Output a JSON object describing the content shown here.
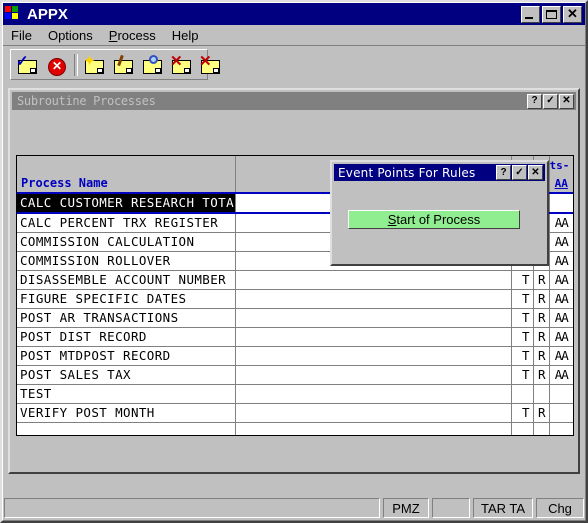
{
  "window": {
    "title": "APPX",
    "icon": "windows-logo-icon",
    "controls": [
      {
        "name": "minimize-button",
        "glyph": "_"
      },
      {
        "name": "maximize-button",
        "glyph": "□"
      },
      {
        "name": "close-button",
        "glyph": "✕"
      }
    ]
  },
  "menubar": {
    "items": [
      {
        "label": "File",
        "accel": ""
      },
      {
        "label": "Options",
        "accel": ""
      },
      {
        "label": "Process",
        "accel": "P"
      },
      {
        "label": "Help",
        "accel": ""
      }
    ]
  },
  "toolbar": {
    "buttons": [
      {
        "name": "confirm-folder-icon",
        "tip": "OK"
      },
      {
        "name": "cancel-circle-icon",
        "tip": "Cancel"
      },
      {
        "name": "new-folder-icon",
        "tip": "New"
      },
      {
        "name": "edit-folder-icon",
        "tip": "Edit"
      },
      {
        "name": "scan-folder-icon",
        "tip": "Scan"
      },
      {
        "name": "delete-folder-icon",
        "tip": "Delete"
      },
      {
        "name": "delete-all-folder-icon",
        "tip": "Delete All"
      }
    ]
  },
  "mdi": {
    "title": "Subroutine Processes",
    "buttons": [
      {
        "name": "help-button",
        "glyph": "?"
      },
      {
        "name": "accept-button",
        "glyph": "✓"
      },
      {
        "name": "cancel-button",
        "glyph": "✕"
      }
    ]
  },
  "grid": {
    "headers": {
      "name": "Process Name",
      "blank": "",
      "t": "",
      "r": "",
      "cut": "ts-",
      "aa": "AA"
    },
    "rows": [
      {
        "name": "CALC CUSTOMER RESEARCH TOTALS",
        "blank": "",
        "t": "",
        "r": "",
        "aa": "",
        "selected": true
      },
      {
        "name": "CALC PERCENT TRX REGISTER",
        "blank": "",
        "t": "",
        "r": "",
        "aa": "AA",
        "selected": false
      },
      {
        "name": "COMMISSION CALCULATION",
        "blank": "",
        "t": "",
        "r": "",
        "aa": "AA",
        "selected": false
      },
      {
        "name": "COMMISSION ROLLOVER",
        "blank": "",
        "t": "",
        "r": "",
        "aa": "AA",
        "selected": false
      },
      {
        "name": "DISASSEMBLE ACCOUNT NUMBER",
        "blank": "",
        "t": "T",
        "r": "R",
        "aa": "AA",
        "selected": false
      },
      {
        "name": "FIGURE SPECIFIC DATES",
        "blank": "",
        "t": "T",
        "r": "R",
        "aa": "AA",
        "selected": false
      },
      {
        "name": "POST AR TRANSACTIONS",
        "blank": "",
        "t": "T",
        "r": "R",
        "aa": "AA",
        "selected": false
      },
      {
        "name": "POST DIST RECORD",
        "blank": "",
        "t": "T",
        "r": "R",
        "aa": "AA",
        "selected": false
      },
      {
        "name": "POST MTDPOST RECORD",
        "blank": "",
        "t": "T",
        "r": "R",
        "aa": "AA",
        "selected": false
      },
      {
        "name": "POST SALES TAX",
        "blank": "",
        "t": "T",
        "r": "R",
        "aa": "AA",
        "selected": false
      },
      {
        "name": "TEST",
        "blank": "",
        "t": "",
        "r": "",
        "aa": "",
        "selected": false
      },
      {
        "name": "VERIFY POST MONTH",
        "blank": "",
        "t": "T",
        "r": "R",
        "aa": "",
        "selected": false
      },
      {
        "name": "",
        "blank": "",
        "t": "",
        "r": "",
        "aa": "",
        "selected": false
      }
    ]
  },
  "dialog": {
    "title": "Event Points For Rules",
    "buttons": [
      {
        "name": "help-button",
        "glyph": "?"
      },
      {
        "name": "accept-button",
        "glyph": "✓"
      },
      {
        "name": "cancel-button",
        "glyph": "✕"
      }
    ],
    "action": {
      "label_before": "",
      "accel": "S",
      "label_after": "tart of Process",
      "full_label": "Start of Process",
      "color": "#90ee90"
    }
  },
  "statusbar": {
    "message": "",
    "panel_pmz": "PMZ",
    "panel_blank": "",
    "panel_tar": "TAR TA",
    "panel_mode": "Chg"
  },
  "colors": {
    "titlebar_active": "#000080",
    "titlebar_inactive": "#808080",
    "face": "#c0c0c0",
    "accent_blue": "#0000c0",
    "button_green": "#90ee90"
  }
}
